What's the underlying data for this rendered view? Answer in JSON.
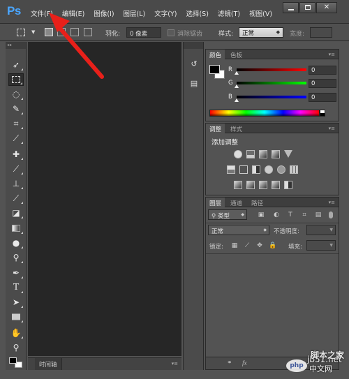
{
  "app": {
    "logo": "Ps",
    "menu": [
      "文件(F)",
      "编辑(E)",
      "图像(I)",
      "图层(L)",
      "文字(Y)",
      "选择(S)",
      "滤镜(T)",
      "视图(V)"
    ]
  },
  "options": {
    "feather_label": "羽化:",
    "feather_value": "0 像素",
    "antialias_label": "消除锯齿",
    "style_label": "样式:",
    "style_value": "正常",
    "width_label": "宽度:"
  },
  "color_panel": {
    "tabs": [
      "颜色",
      "色板"
    ],
    "sliders": [
      {
        "label": "R",
        "value": "0",
        "color": "#ff0000"
      },
      {
        "label": "G",
        "value": "0",
        "color": "#00ff00"
      },
      {
        "label": "B",
        "value": "0",
        "color": "#0000ff"
      }
    ]
  },
  "adjust_panel": {
    "tabs": [
      "调整",
      "样式"
    ],
    "title": "添加调整"
  },
  "layers_panel": {
    "tabs": [
      "图层",
      "通道",
      "路径"
    ],
    "filter_label": "类型",
    "blend_mode": "正常",
    "opacity_label": "不透明度:",
    "lock_label": "锁定:",
    "fill_label": "填充:"
  },
  "timeline": {
    "tab": "时间轴"
  },
  "watermark": {
    "site": "jb51.net",
    "brand": "脚本之家",
    "badge": "php",
    "cn": "中文网"
  }
}
